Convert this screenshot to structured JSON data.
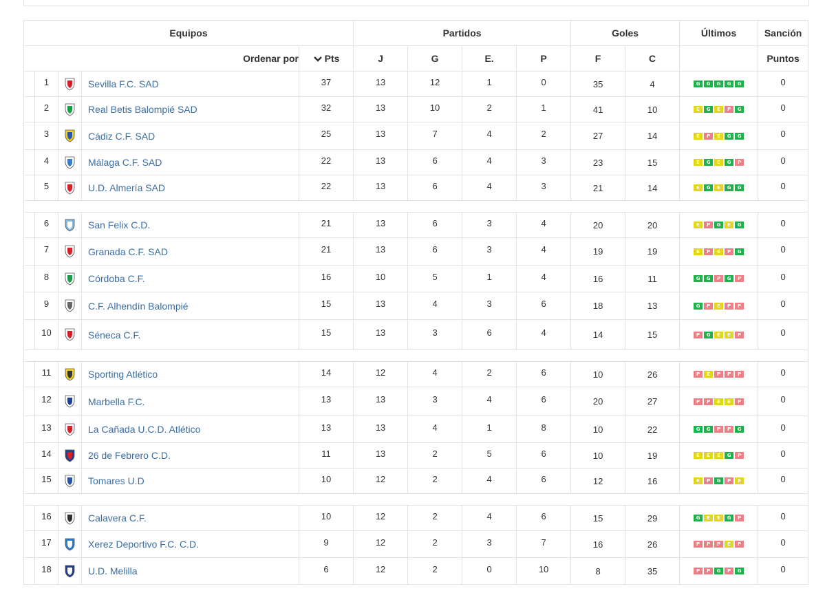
{
  "headers": {
    "equipos": "Equipos",
    "partidos": "Partidos",
    "goles": "Goles",
    "ultimos": "Últimos",
    "sancion": "Sanción",
    "ordenar": "Ordenar por",
    "pts": "Pts",
    "j": "J",
    "g": "G",
    "e": "E.",
    "p": "P",
    "f": "F",
    "c": "C",
    "puntos": "Puntos"
  },
  "colors": {
    "link": "#3a6ea5",
    "win": "#1db34a",
    "draw": "#e3d61b",
    "loss": "#ef7f86"
  },
  "teams": [
    {
      "pos": "1",
      "name": "Sevilla F.C. SAD",
      "pts": "37",
      "j": "13",
      "g": "12",
      "e": "1",
      "p": "0",
      "f": "35",
      "c": "4",
      "last": [
        "G",
        "G",
        "G",
        "G",
        "G"
      ],
      "sancion": "0",
      "crest": "sevilla-crest-icon"
    },
    {
      "pos": "2",
      "name": "Real Betis Balompié SAD",
      "pts": "32",
      "j": "13",
      "g": "10",
      "e": "2",
      "p": "1",
      "f": "41",
      "c": "10",
      "last": [
        "E",
        "G",
        "E",
        "P",
        "G"
      ],
      "sancion": "0",
      "crest": "betis-crest-icon"
    },
    {
      "pos": "3",
      "name": "Cádiz C.F. SAD",
      "pts": "25",
      "j": "13",
      "g": "7",
      "e": "4",
      "p": "2",
      "f": "27",
      "c": "14",
      "last": [
        "E",
        "P",
        "E",
        "G",
        "G"
      ],
      "sancion": "0",
      "crest": "cadiz-crest-icon"
    },
    {
      "pos": "4",
      "name": "Málaga C.F. SAD",
      "pts": "22",
      "j": "13",
      "g": "6",
      "e": "4",
      "p": "3",
      "f": "23",
      "c": "15",
      "last": [
        "E",
        "G",
        "E",
        "G",
        "P"
      ],
      "sancion": "0",
      "crest": "malaga-crest-icon"
    },
    {
      "pos": "5",
      "name": "U.D. Almería SAD",
      "pts": "22",
      "j": "13",
      "g": "6",
      "e": "4",
      "p": "3",
      "f": "21",
      "c": "14",
      "last": [
        "E",
        "G",
        "E",
        "G",
        "G"
      ],
      "sancion": "0",
      "crest": "almeria-crest-icon"
    },
    {
      "pos": "6",
      "name": "San Felix C.D.",
      "pts": "21",
      "j": "13",
      "g": "6",
      "e": "3",
      "p": "4",
      "f": "20",
      "c": "20",
      "last": [
        "E",
        "P",
        "G",
        "E",
        "G"
      ],
      "sancion": "0",
      "crest": "san-felix-crest-icon"
    },
    {
      "pos": "7",
      "name": "Granada C.F. SAD",
      "pts": "21",
      "j": "13",
      "g": "6",
      "e": "3",
      "p": "4",
      "f": "19",
      "c": "19",
      "last": [
        "E",
        "P",
        "E",
        "P",
        "G"
      ],
      "sancion": "0",
      "crest": "granada-crest-icon"
    },
    {
      "pos": "8",
      "name": "Córdoba C.F.",
      "pts": "16",
      "j": "10",
      "g": "5",
      "e": "1",
      "p": "4",
      "f": "16",
      "c": "11",
      "last": [
        "G",
        "G",
        "P",
        "G",
        "P"
      ],
      "sancion": "0",
      "crest": "cordoba-crest-icon"
    },
    {
      "pos": "9",
      "name": "C.F. Alhendín Balompié",
      "pts": "15",
      "j": "13",
      "g": "4",
      "e": "3",
      "p": "6",
      "f": "18",
      "c": "13",
      "last": [
        "G",
        "P",
        "E",
        "P",
        "P"
      ],
      "sancion": "0",
      "crest": "alhendin-crest-icon"
    },
    {
      "pos": "10",
      "name": "Séneca C.F.",
      "pts": "15",
      "j": "13",
      "g": "3",
      "e": "6",
      "p": "4",
      "f": "14",
      "c": "15",
      "last": [
        "P",
        "G",
        "E",
        "E",
        "P"
      ],
      "sancion": "0",
      "crest": "seneca-crest-icon"
    },
    {
      "pos": "11",
      "name": "Sporting Atlético",
      "pts": "14",
      "j": "12",
      "g": "4",
      "e": "2",
      "p": "6",
      "f": "10",
      "c": "26",
      "last": [
        "P",
        "E",
        "P",
        "P",
        "P"
      ],
      "sancion": "0",
      "crest": "sporting-atletico-crest-icon"
    },
    {
      "pos": "12",
      "name": "Marbella F.C.",
      "pts": "13",
      "j": "13",
      "g": "3",
      "e": "4",
      "p": "6",
      "f": "20",
      "c": "27",
      "last": [
        "P",
        "P",
        "E",
        "E",
        "P"
      ],
      "sancion": "0",
      "crest": "marbella-crest-icon"
    },
    {
      "pos": "13",
      "name": "La Cañada U.C.D. Atlético",
      "pts": "13",
      "j": "13",
      "g": "4",
      "e": "1",
      "p": "8",
      "f": "10",
      "c": "22",
      "last": [
        "G",
        "G",
        "P",
        "P",
        "G"
      ],
      "sancion": "0",
      "crest": "la-canada-crest-icon"
    },
    {
      "pos": "14",
      "name": "26 de Febrero C.D.",
      "pts": "11",
      "j": "13",
      "g": "2",
      "e": "5",
      "p": "6",
      "f": "10",
      "c": "19",
      "last": [
        "E",
        "E",
        "E",
        "G",
        "P"
      ],
      "sancion": "0",
      "crest": "26-febrero-crest-icon"
    },
    {
      "pos": "15",
      "name": "Tomares U.D",
      "pts": "10",
      "j": "12",
      "g": "2",
      "e": "4",
      "p": "6",
      "f": "12",
      "c": "16",
      "last": [
        "E",
        "P",
        "G",
        "P",
        "E"
      ],
      "sancion": "0",
      "crest": "tomares-crest-icon"
    },
    {
      "pos": "16",
      "name": "Calavera C.F.",
      "pts": "10",
      "j": "12",
      "g": "2",
      "e": "4",
      "p": "6",
      "f": "15",
      "c": "29",
      "last": [
        "G",
        "E",
        "E",
        "G",
        "P"
      ],
      "sancion": "0",
      "crest": "calavera-crest-icon"
    },
    {
      "pos": "17",
      "name": "Xerez Deportivo F.C. C.D.",
      "pts": "9",
      "j": "12",
      "g": "2",
      "e": "3",
      "p": "7",
      "f": "16",
      "c": "26",
      "last": [
        "P",
        "P",
        "P",
        "E",
        "P"
      ],
      "sancion": "0",
      "crest": "xerez-crest-icon"
    },
    {
      "pos": "18",
      "name": "U.D. Melilla",
      "pts": "6",
      "j": "12",
      "g": "2",
      "e": "0",
      "p": "10",
      "f": "8",
      "c": "35",
      "last": [
        "P",
        "P",
        "G",
        "P",
        "G"
      ],
      "sancion": "0",
      "crest": "melilla-crest-icon"
    }
  ]
}
